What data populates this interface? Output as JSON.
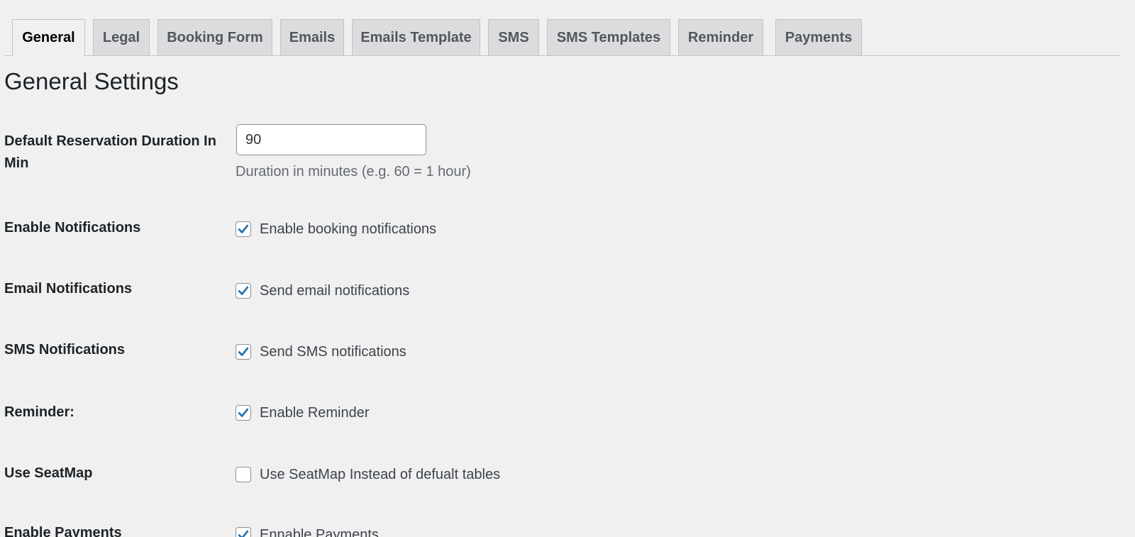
{
  "tabs": [
    {
      "label": "General",
      "active": true
    },
    {
      "label": "Legal"
    },
    {
      "label": "Booking Form"
    },
    {
      "label": "Emails"
    },
    {
      "label": "Emails Template"
    },
    {
      "label": "SMS"
    },
    {
      "label": "SMS Templates"
    },
    {
      "label": "Reminder"
    },
    {
      "label": "Payments"
    }
  ],
  "page_title": "General Settings",
  "duration": {
    "label": "Default Reservation Duration In Min",
    "value": "90",
    "description": "Duration in minutes (e.g. 60 = 1 hour)"
  },
  "settings": [
    {
      "label": "Enable Notifications",
      "option": "Enable booking notifications",
      "checked": true
    },
    {
      "label": "Email Notifications",
      "option": "Send email notifications",
      "checked": true
    },
    {
      "label": "SMS Notifications",
      "option": "Send SMS notifications",
      "checked": true
    },
    {
      "label": "Reminder:",
      "option": "Enable Reminder",
      "checked": true
    },
    {
      "label": "Use SeatMap",
      "option": "Use SeatMap Instead of defualt tables",
      "checked": false
    },
    {
      "label": "Enable Payments",
      "option": "Ennable Payments",
      "checked": true
    }
  ],
  "colors": {
    "check_accent": "#2271b1",
    "background": "#f0f0f1"
  }
}
